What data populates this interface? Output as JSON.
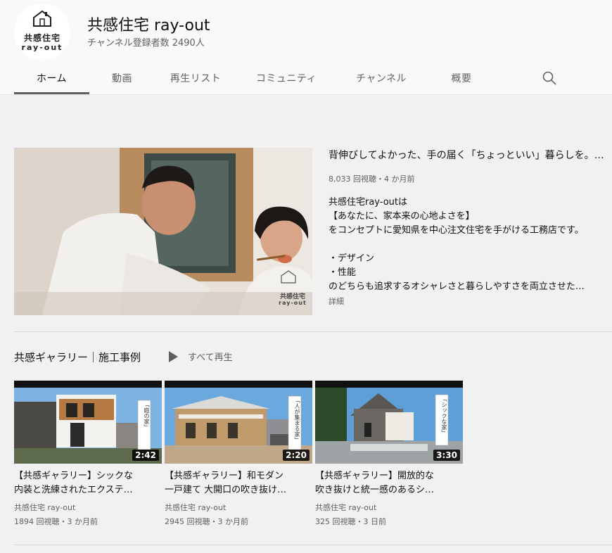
{
  "channel": {
    "name": "共感住宅 ray-out",
    "subscribers": "チャンネル登録者数 2490人",
    "logo_text_jp": "共感住宅",
    "logo_text_en": "ray-out"
  },
  "tabs": [
    {
      "label": "ホーム",
      "active": true
    },
    {
      "label": "動画",
      "active": false
    },
    {
      "label": "再生リスト",
      "active": false
    },
    {
      "label": "コミュニティ",
      "active": false
    },
    {
      "label": "チャンネル",
      "active": false
    },
    {
      "label": "概要",
      "active": false
    }
  ],
  "search_icon": "search-icon",
  "featured": {
    "title": "背伸びしてよかった、手の届く「ちょっといい」暮らしを。…",
    "meta": "8,033 回視聴・4 か月前",
    "watermark_jp": "共感住宅",
    "watermark_en": "ray-out",
    "description": [
      "共感住宅ray-outは",
      "【あなたに、家本来の心地よさを】",
      "をコンセプトに愛知県を中心注文住宅を手がける工務店です。",
      "",
      "・デザイン",
      "・性能",
      "のどちらも追求するオシャレさと暮らしやすさを両立させた…"
    ],
    "more_label": "詳細"
  },
  "shelf": {
    "title": "共感ギャラリー｜施工事例",
    "play_all": "すべて再生",
    "videos": [
      {
        "title_lines": [
          "【共感ギャラリー】シックな",
          "内装と洗練されたエクステ…"
        ],
        "channel": "共感住宅 ray-out",
        "meta": "1894 回視聴・3 か月前",
        "duration": "2:42",
        "overlay": "「庭の家」"
      },
      {
        "title_lines": [
          "【共感ギャラリー】和モダン",
          "一戸建て 大開口の吹き抜け…"
        ],
        "channel": "共感住宅 ray-out",
        "meta": "2945 回視聴・3 か月前",
        "duration": "2:20",
        "overlay": "「人が集まる家」"
      },
      {
        "title_lines": [
          "【共感ギャラリー】開放的な",
          "吹き抜けと統一感のあるシ…"
        ],
        "channel": "共感住宅 ray-out",
        "meta": "325 回視聴・3 日前",
        "duration": "3:30",
        "overlay": "「シックな家」"
      }
    ]
  },
  "colors": {
    "background": "#f1f1f1",
    "header_bg": "#f9f9f9",
    "text_primary": "#0f0f0f",
    "text_secondary": "#606060"
  }
}
